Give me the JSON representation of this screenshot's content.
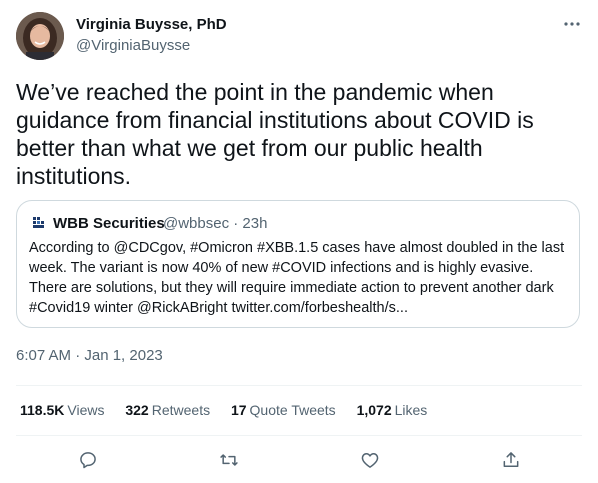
{
  "author": {
    "name": "Virginia Buysse, PhD",
    "handle": "@VirginiaBuysse"
  },
  "tweet": {
    "text": "We’ve reached the point in the pandemic when guidance from financial institutions about COVID is better than what we get from our public health institutions."
  },
  "quote": {
    "name": "WBB Securities",
    "meta": "@wbbsec · 23h",
    "text": "According to @CDCgov, #Omicron #XBB.1.5 cases have almost doubled in the last week. The variant is now 40% of new #COVID infections and is highly evasive. There are solutions, but they will require immediate action to prevent another dark #Covid19 winter @RickABright twitter.com/forbeshealth/s..."
  },
  "timestamp": "6:07 AM · Jan 1, 2023",
  "stats": {
    "views_count": "118.5K",
    "views_label": "Views",
    "retweets_count": "322",
    "retweets_label": "Retweets",
    "quotes_count": "17",
    "quotes_label": "Quote Tweets",
    "likes_count": "1,072",
    "likes_label": "Likes"
  },
  "actions": [
    "reply-icon",
    "retweet-icon",
    "like-icon",
    "share-icon"
  ],
  "colors": {
    "text": "#0f1419",
    "secondary": "#536471",
    "border": "#cfd9de",
    "divider": "#eff3f4"
  }
}
